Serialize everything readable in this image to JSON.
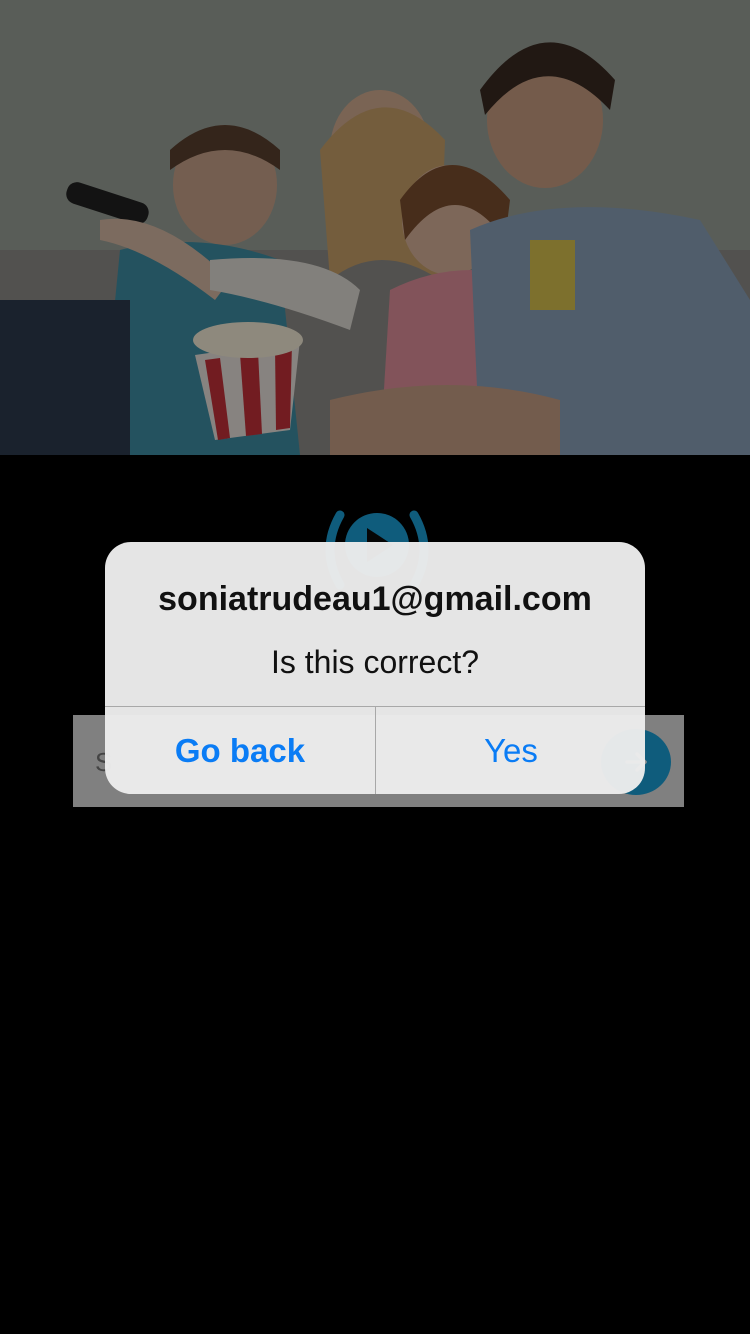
{
  "hero": {
    "image_description_icon": "family-watching-tv-photo"
  },
  "logo": {
    "icon": "play-broadcast-icon",
    "color": "#1b9fd6"
  },
  "email_form": {
    "placeholder": "S",
    "submit_icon": "arrow-right-icon"
  },
  "alert": {
    "title": "soniatrudeau1@gmail.com",
    "message": "Is this correct?",
    "go_back_label": "Go back",
    "yes_label": "Yes",
    "button_color": "#0a7cf5"
  }
}
